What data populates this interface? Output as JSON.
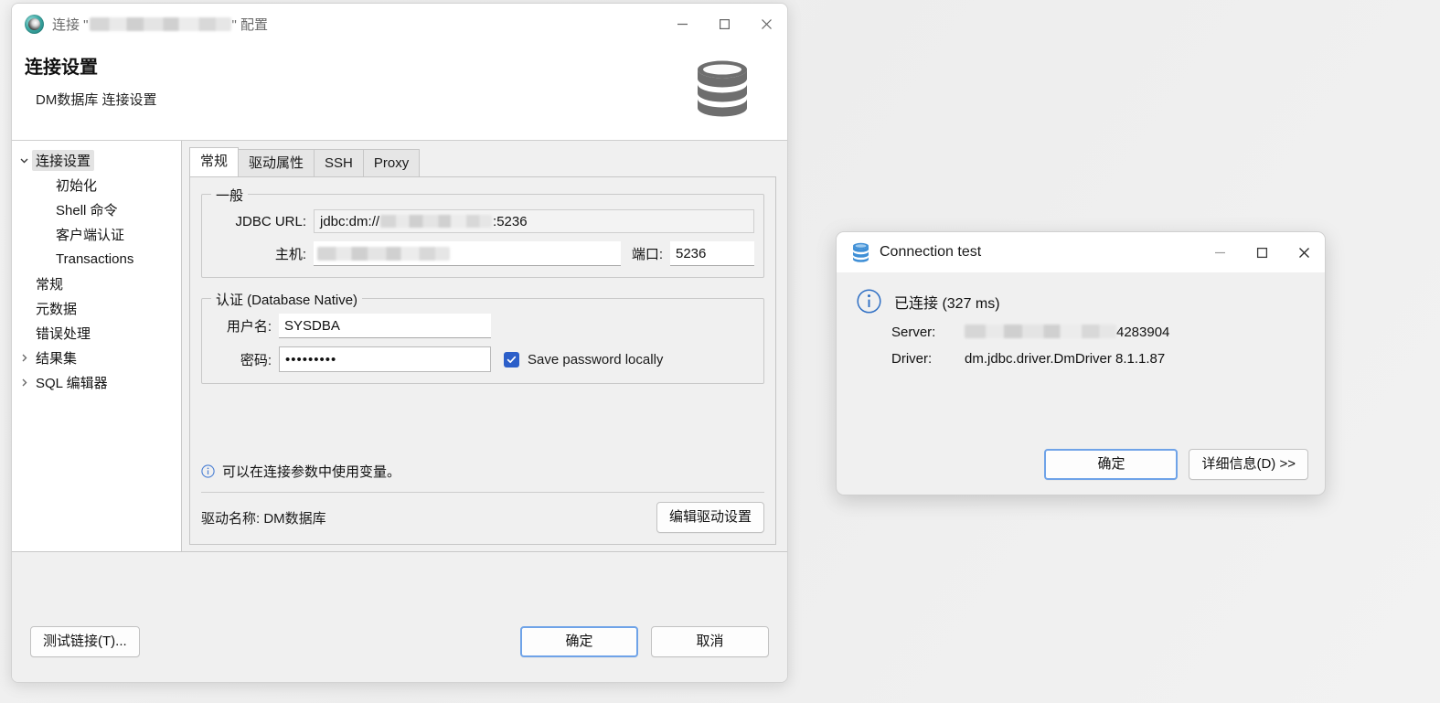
{
  "window": {
    "title_prefix": "连接 \"",
    "title_suffix": "\" 配置",
    "app_icon": "dbeaver-icon",
    "controls": {
      "minimize": "minimize-icon",
      "maximize": "maximize-icon",
      "close": "close-icon"
    },
    "header": {
      "title": "连接设置",
      "subtitle": "DM数据库 连接设置",
      "icon": "database-icon"
    }
  },
  "tree": {
    "items": [
      {
        "label": "连接设置",
        "indent": 0,
        "twisty": "chevron-down",
        "selected": true
      },
      {
        "label": "初始化",
        "indent": 2,
        "twisty": "",
        "selected": false
      },
      {
        "label": "Shell 命令",
        "indent": 2,
        "twisty": "",
        "selected": false
      },
      {
        "label": "客户端认证",
        "indent": 2,
        "twisty": "",
        "selected": false
      },
      {
        "label": "Transactions",
        "indent": 2,
        "twisty": "",
        "selected": false
      },
      {
        "label": "常规",
        "indent": 1,
        "twisty": "",
        "selected": false
      },
      {
        "label": "元数据",
        "indent": 1,
        "twisty": "",
        "selected": false
      },
      {
        "label": "错误处理",
        "indent": 1,
        "twisty": "",
        "selected": false
      },
      {
        "label": "结果集",
        "indent": 0,
        "twisty": "chevron-right",
        "selected": false
      },
      {
        "label": "SQL 编辑器",
        "indent": 0,
        "twisty": "chevron-right",
        "selected": false
      }
    ]
  },
  "tabs": [
    {
      "label": "常规",
      "active": true
    },
    {
      "label": "驱动属性",
      "active": false
    },
    {
      "label": "SSH",
      "active": false
    },
    {
      "label": "Proxy",
      "active": false
    }
  ],
  "general_group": {
    "title": "一般",
    "jdbc_label": "JDBC URL:",
    "jdbc_prefix": "jdbc:dm://",
    "jdbc_suffix": ":5236",
    "host_label": "主机:",
    "host_value": "",
    "port_label": "端口:",
    "port_value": "5236"
  },
  "auth_group": {
    "title": "认证 (Database Native)",
    "user_label": "用户名:",
    "user_value": "SYSDBA",
    "password_label": "密码:",
    "password_value": "•••••••••",
    "save_password_label": "Save password locally",
    "save_password_checked": true
  },
  "hint": {
    "icon": "info-icon",
    "text": "可以在连接参数中使用变量。"
  },
  "driver": {
    "label": "驱动名称: DM数据库",
    "edit_button": "编辑驱动设置"
  },
  "footer": {
    "test_button": "测试链接(T)...",
    "ok_button": "确定",
    "cancel_button": "取消"
  },
  "dialog": {
    "icon": "database-icon",
    "title": "Connection test",
    "controls": {
      "minimize": "minimize-icon",
      "maximize": "maximize-icon",
      "close": "close-icon"
    },
    "status_icon": "info-circle-icon",
    "status_text": "已连接 (327 ms)",
    "rows": [
      {
        "key": "Server:",
        "value": "4283904",
        "blurred": true
      },
      {
        "key": "Driver:",
        "value": "dm.jdbc.driver.DmDriver 8.1.1.87",
        "blurred": false
      }
    ],
    "ok_button": "确定",
    "details_button": "详细信息(D) >>"
  },
  "colors": {
    "accent_blue": "#2c5fc9",
    "default_button_border": "#6fa3e8",
    "dialog_db_icon": "#3f8fd6",
    "header_db_icon": "#6e6e6e",
    "window_bg": "#f0f0f0",
    "panel_white": "#ffffff"
  }
}
